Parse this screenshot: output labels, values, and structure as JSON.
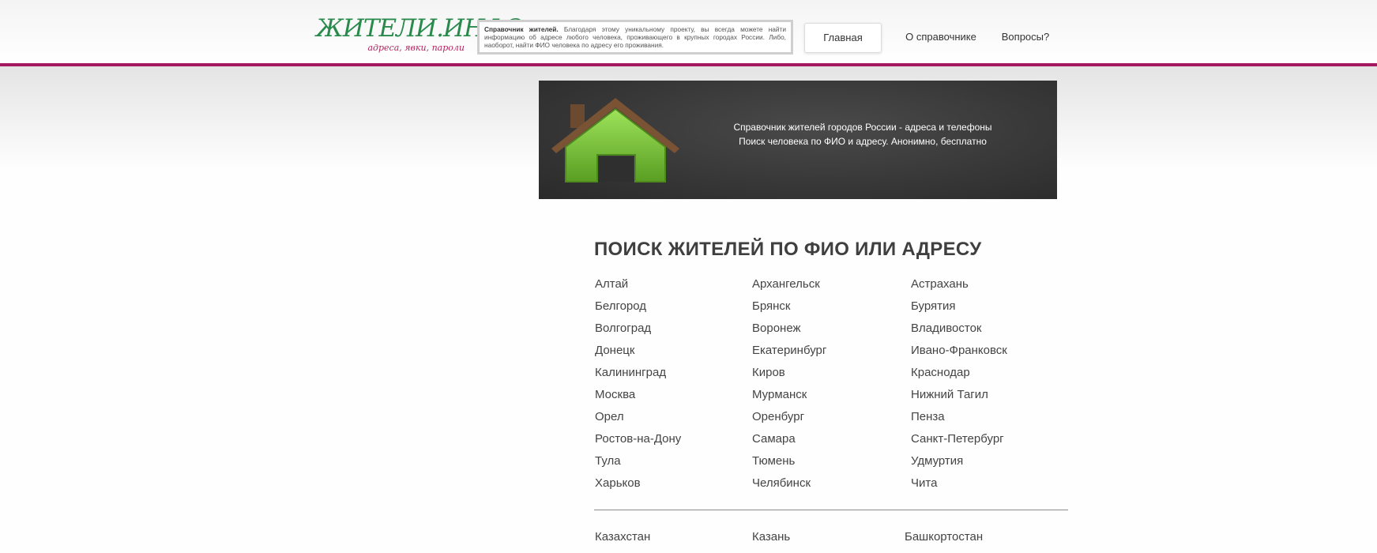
{
  "header": {
    "logo_title": "ЖИТЕЛИ.ИНФО",
    "logo_subtitle": "адреса, явки, пароли",
    "about_bold": "Справочник жителей.",
    "about_text": " Благодаря этому уникальному проекту, вы всегда можете найти информацию об адресе любого человека, проживающего в крупных городах России. Либо, наоборот, найти ФИО человека по адресу его проживания.",
    "nav": {
      "home": "Главная",
      "about": "О справочнике",
      "faq": "Вопросы?"
    },
    "accent_color": "#a3185f",
    "logo_color": "#2a8a4c"
  },
  "banner": {
    "line1": "Справочник жителей городов России - адреса и телефоны",
    "line2": "Поиск человека по ФИО и адресу. Анонимно, бесплатно",
    "icon": "house-icon",
    "background_color": "#3a3a3a"
  },
  "main": {
    "title": "ПОИСК ЖИТЕЛЕЙ ПО ФИО ИЛИ АДРЕСУ",
    "cities": [
      [
        "Алтай",
        "Архангельск",
        "Астрахань"
      ],
      [
        "Белгород",
        "Брянск",
        "Бурятия"
      ],
      [
        "Волгоград",
        "Воронеж",
        "Владивосток"
      ],
      [
        "Донецк",
        "Екатеринбург",
        "Ивано-Франковск"
      ],
      [
        "Калининград",
        "Киров",
        "Краснодар"
      ],
      [
        "Москва",
        "Мурманск",
        "Нижний Тагил"
      ],
      [
        "Орел",
        "Оренбург",
        "Пенза"
      ],
      [
        "Ростов-на-Дону",
        "Самара",
        "Санкт-Петербург"
      ],
      [
        "Тула",
        "Тюмень",
        "Удмуртия"
      ],
      [
        "Харьков",
        "Челябинск",
        "Чита"
      ]
    ],
    "extra_regions": [
      "Казахстан",
      "Казань",
      "Башкортостан"
    ]
  }
}
